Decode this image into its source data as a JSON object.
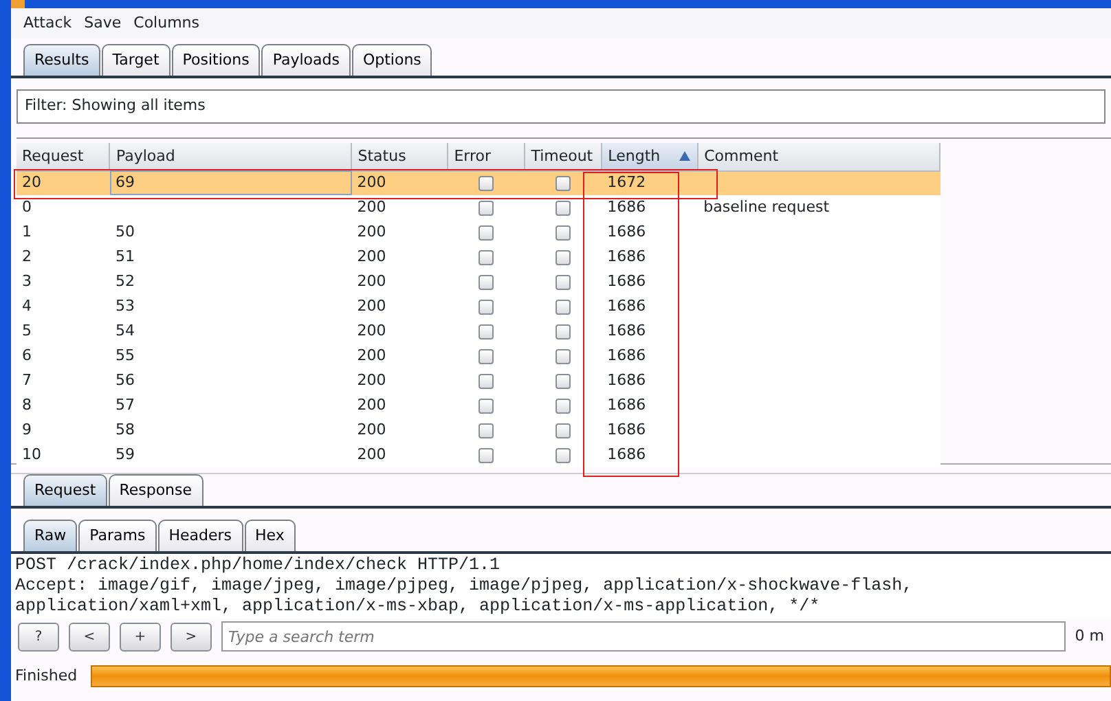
{
  "menu": [
    "Attack",
    "Save",
    "Columns"
  ],
  "tabs": [
    {
      "label": "Results",
      "selected": true
    },
    {
      "label": "Target",
      "selected": false
    },
    {
      "label": "Positions",
      "selected": false
    },
    {
      "label": "Payloads",
      "selected": false
    },
    {
      "label": "Options",
      "selected": false
    }
  ],
  "filter": "Filter:  Showing all items",
  "table": {
    "columns": [
      {
        "label": "Request",
        "sorted": false,
        "outlined": false
      },
      {
        "label": "Payload",
        "sorted": false,
        "outlined": false
      },
      {
        "label": "Status",
        "sorted": false,
        "outlined": false
      },
      {
        "label": "Error",
        "sorted": false,
        "outlined": false
      },
      {
        "label": "Timeout",
        "sorted": false,
        "outlined": false
      },
      {
        "label": "Length",
        "sorted": true,
        "outlined": true
      },
      {
        "label": "Comment",
        "sorted": false,
        "outlined": false
      }
    ],
    "rows": [
      {
        "request": "20",
        "payload": "69",
        "status": "200",
        "error": false,
        "timeout": false,
        "length": "1672",
        "comment": "",
        "selected": true,
        "outlined": true
      },
      {
        "request": "0",
        "payload": "",
        "status": "200",
        "error": false,
        "timeout": false,
        "length": "1686",
        "comment": "baseline request",
        "selected": false,
        "outlined": false
      },
      {
        "request": "1",
        "payload": "50",
        "status": "200",
        "error": false,
        "timeout": false,
        "length": "1686",
        "comment": "",
        "selected": false,
        "outlined": false
      },
      {
        "request": "2",
        "payload": "51",
        "status": "200",
        "error": false,
        "timeout": false,
        "length": "1686",
        "comment": "",
        "selected": false,
        "outlined": false
      },
      {
        "request": "3",
        "payload": "52",
        "status": "200",
        "error": false,
        "timeout": false,
        "length": "1686",
        "comment": "",
        "selected": false,
        "outlined": false
      },
      {
        "request": "4",
        "payload": "53",
        "status": "200",
        "error": false,
        "timeout": false,
        "length": "1686",
        "comment": "",
        "selected": false,
        "outlined": false
      },
      {
        "request": "5",
        "payload": "54",
        "status": "200",
        "error": false,
        "timeout": false,
        "length": "1686",
        "comment": "",
        "selected": false,
        "outlined": false
      },
      {
        "request": "6",
        "payload": "55",
        "status": "200",
        "error": false,
        "timeout": false,
        "length": "1686",
        "comment": "",
        "selected": false,
        "outlined": false
      },
      {
        "request": "7",
        "payload": "56",
        "status": "200",
        "error": false,
        "timeout": false,
        "length": "1686",
        "comment": "",
        "selected": false,
        "outlined": false
      },
      {
        "request": "8",
        "payload": "57",
        "status": "200",
        "error": false,
        "timeout": false,
        "length": "1686",
        "comment": "",
        "selected": false,
        "outlined": false
      },
      {
        "request": "9",
        "payload": "58",
        "status": "200",
        "error": false,
        "timeout": false,
        "length": "1686",
        "comment": "",
        "selected": false,
        "outlined": false
      },
      {
        "request": "10",
        "payload": "59",
        "status": "200",
        "error": false,
        "timeout": false,
        "length": "1686",
        "comment": "",
        "selected": false,
        "outlined": false
      }
    ]
  },
  "message_tabs": [
    {
      "label": "Request",
      "selected": true
    },
    {
      "label": "Response",
      "selected": false
    }
  ],
  "view_tabs": [
    {
      "label": "Raw",
      "selected": true
    },
    {
      "label": "Params",
      "selected": false
    },
    {
      "label": "Headers",
      "selected": false
    },
    {
      "label": "Hex",
      "selected": false
    }
  ],
  "raw_lines": [
    "POST /crack/index.php/home/index/check HTTP/1.1",
    "Accept: image/gif, image/jpeg, image/pjpeg, image/pjpeg, application/x-shockwave-flash,",
    "application/xaml+xml, application/x-ms-xbap, application/x-ms-application, */*"
  ],
  "search": {
    "buttons": [
      "?",
      "<",
      "+",
      ">"
    ],
    "placeholder": "Type a search term",
    "matches": "0 m"
  },
  "status": {
    "label": "Finished",
    "level": 1
  }
}
